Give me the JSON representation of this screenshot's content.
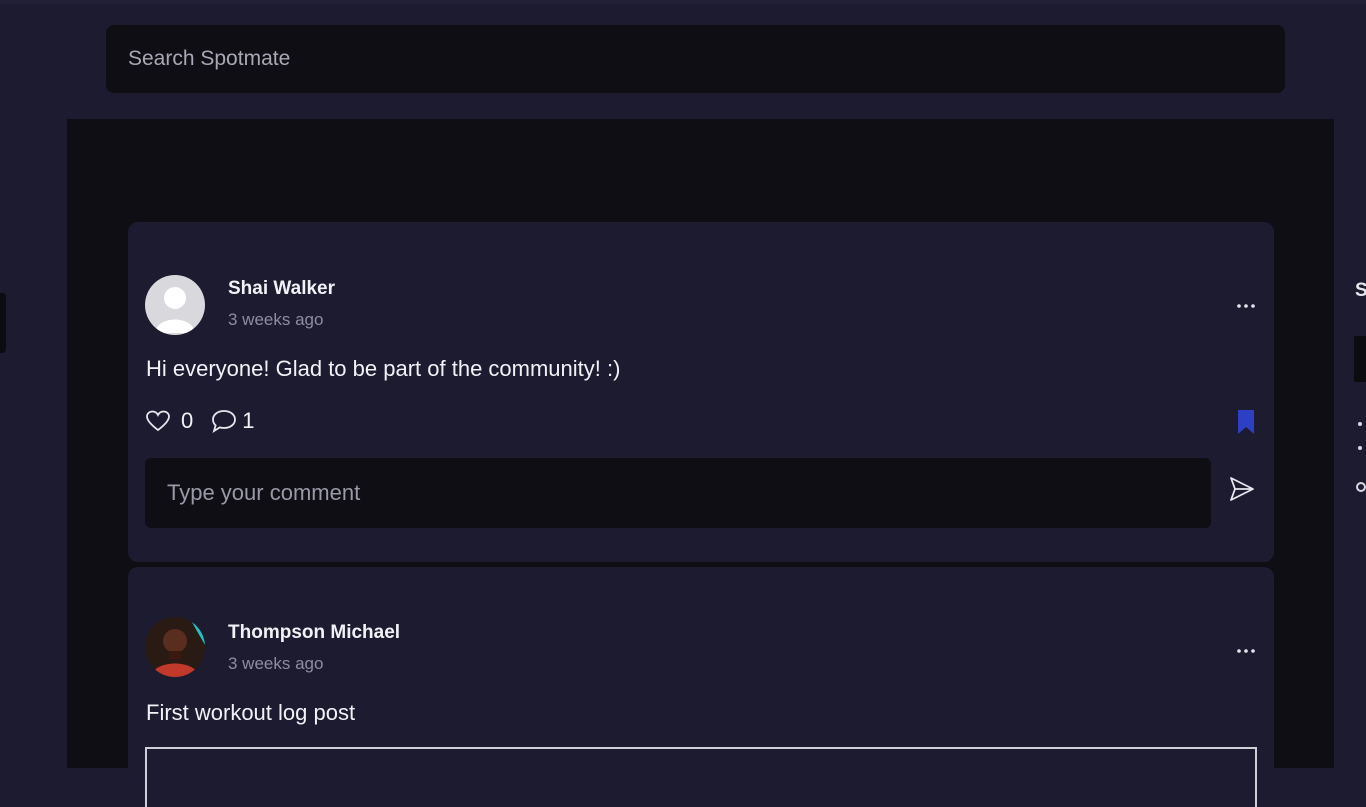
{
  "search": {
    "placeholder": "Search Spotmate"
  },
  "posts": [
    {
      "author": "Shai Walker",
      "time": "3 weeks ago",
      "text": "Hi everyone! Glad to be part of the community! :)",
      "likes": "0",
      "comments": "1",
      "comment_placeholder": "Type your comment",
      "avatar_icon": "default-user-avatar"
    },
    {
      "author": "Thompson Michael",
      "time": "3 weeks ago",
      "text": "First workout log post",
      "avatar_icon": "user-photo-avatar"
    }
  ],
  "right_panel": {
    "letter": "S"
  },
  "colors": {
    "background": "#1d1b30",
    "feed_background": "#0e0e14",
    "input_background": "#0e0e14",
    "bookmark": "#2f3fc4"
  }
}
